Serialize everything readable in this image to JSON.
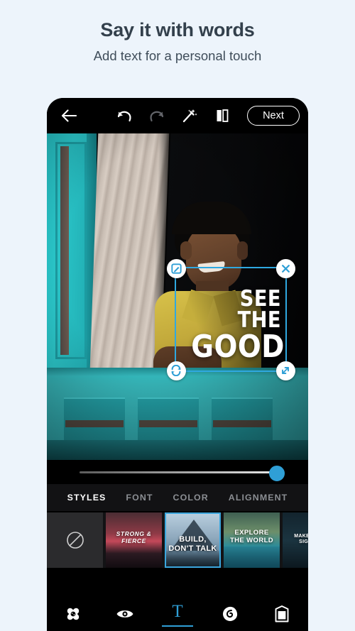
{
  "promo": {
    "title": "Say it with words",
    "subtitle": "Add text for a personal touch"
  },
  "colors": {
    "page_bg": "#edf4fb",
    "accent_blue": "#2f9fd6",
    "selection_blue": "#2fa8e0",
    "thumb_selected_border": "#3ba6dd",
    "toolbar_bg": "#000000",
    "panel_bg": "#131315"
  },
  "toolbar": {
    "back_icon": "arrow-left-icon",
    "undo_icon": "undo-icon",
    "undo_enabled": true,
    "redo_icon": "redo-icon",
    "redo_enabled": false,
    "magic_icon": "magic-wand-icon",
    "compare_icon": "compare-split-icon",
    "next_label": "Next"
  },
  "canvas": {
    "overlay_text_line1": "SEE THE",
    "overlay_text_line2": "GOOD",
    "handles": {
      "edit": "edit-pencil-icon",
      "close": "close-x-icon",
      "rotate": "rotate-flip-icon",
      "resize": "resize-diagonal-icon"
    }
  },
  "slider": {
    "value": 100,
    "min": 0,
    "max": 100
  },
  "tabs": [
    {
      "label": "STYLES",
      "active": true
    },
    {
      "label": "FONT",
      "active": false
    },
    {
      "label": "COLOR",
      "active": false
    },
    {
      "label": "ALIGNMENT",
      "active": false
    }
  ],
  "styles": [
    {
      "id": "none",
      "label": "",
      "icon": "no-style-icon",
      "selected": false
    },
    {
      "id": "strong",
      "line1": "STRONG &",
      "line2": "FIERCE",
      "selected": false
    },
    {
      "id": "build",
      "line1": "BUILD,",
      "line2": "DON'T TALK",
      "selected": true
    },
    {
      "id": "explore",
      "line1": "EXPLORE",
      "line2": "THE WORLD",
      "selected": false
    },
    {
      "id": "make",
      "line1": "MAKE IT SIM",
      "line2": "SIGNIFIC",
      "selected": false
    }
  ],
  "bottom_nav": [
    {
      "id": "heal",
      "icon": "healing-patch-icon",
      "active": false
    },
    {
      "id": "retouch",
      "icon": "eye-icon",
      "active": false
    },
    {
      "id": "text",
      "icon": "text-t-icon",
      "label": "T",
      "active": true
    },
    {
      "id": "effects",
      "icon": "blend-swirl-icon",
      "active": false
    },
    {
      "id": "frames",
      "icon": "frame-icon",
      "active": false
    }
  ]
}
